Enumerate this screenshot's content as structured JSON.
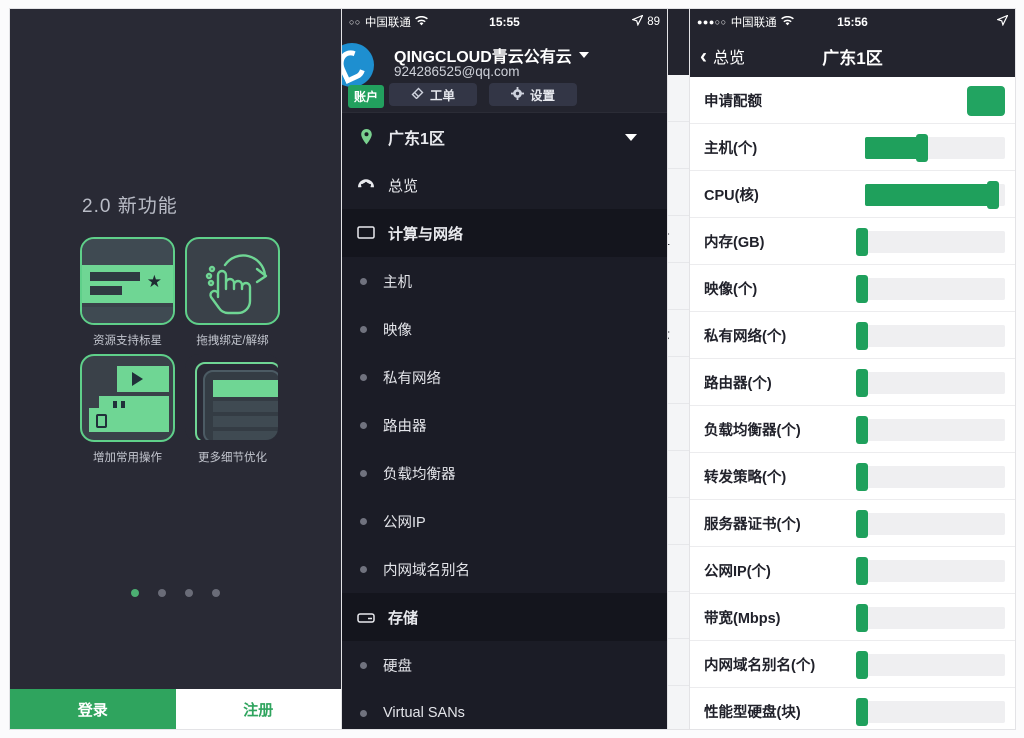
{
  "onboarding": {
    "title": "2.0 新功能",
    "features": [
      {
        "caption": "资源支持标星",
        "art": "starred-card"
      },
      {
        "caption": "拖拽绑定/解绑",
        "art": "drag-hand"
      },
      {
        "caption": "增加常用操作",
        "art": "quick-actions"
      },
      {
        "caption": "更多细节优化",
        "art": "list-detail"
      }
    ],
    "pager": {
      "total": 4,
      "active": 1
    },
    "login_label": "登录",
    "register_label": "注册",
    "accent": "#2fa45e",
    "background": "#292a35"
  },
  "console": {
    "statusbar": {
      "signal_dots": "○○",
      "carrier": "中国联通",
      "wifi_icon": "wifi-icon",
      "time": "15:55",
      "location_icon": "location-arrow-icon",
      "battery": "89"
    },
    "account": {
      "name": "QINGCLOUD青云公有云",
      "email": "924286525@qq.com",
      "badge": "账户",
      "ticket_label": "工单",
      "settings_label": "设置",
      "avatar_icon": "qingcloud-logo-icon",
      "dropdown_icon": "caret-down-icon"
    },
    "zone": {
      "label": "广东1区",
      "pin_icon": "location-pin-icon",
      "caret_icon": "caret-down-icon"
    },
    "menu": [
      {
        "label": "总览",
        "type": "item",
        "icon": "dashboard-icon"
      },
      {
        "label": "计算与网络",
        "type": "section",
        "icon": "monitor-icon"
      },
      {
        "label": "主机",
        "type": "sub",
        "icon": "bullet-icon"
      },
      {
        "label": "映像",
        "type": "sub",
        "icon": "bullet-icon"
      },
      {
        "label": "私有网络",
        "type": "sub",
        "icon": "bullet-icon"
      },
      {
        "label": "路由器",
        "type": "sub",
        "icon": "bullet-icon"
      },
      {
        "label": "负载均衡器",
        "type": "sub",
        "icon": "bullet-icon"
      },
      {
        "label": "公网IP",
        "type": "sub",
        "icon": "bullet-icon"
      },
      {
        "label": "内网域名别名",
        "type": "sub",
        "icon": "bullet-icon"
      },
      {
        "label": "存储",
        "type": "section",
        "icon": "storage-icon"
      },
      {
        "label": "硬盘",
        "type": "sub",
        "icon": "bullet-icon"
      },
      {
        "label": "Virtual SANs",
        "type": "sub",
        "icon": "bullet-icon"
      }
    ]
  },
  "quota": {
    "statusbar": {
      "signal_dots": "●●●○○",
      "carrier": "中国联通",
      "wifi_icon": "wifi-icon",
      "time": "15:56",
      "location_icon": "location-arrow-icon"
    },
    "nav": {
      "back_label": "总览",
      "back_icon": "chevron-left-icon",
      "title": "广东1区"
    },
    "apply_label": "申请配额",
    "apply_button_icon": "apply-quota-button",
    "items": [
      {
        "label": "主机(个)",
        "percent": 45
      },
      {
        "label": "CPU(核)",
        "percent": 96
      },
      {
        "label": "内存(GB)",
        "percent": 2
      },
      {
        "label": "映像(个)",
        "percent": 2
      },
      {
        "label": "私有网络(个)",
        "percent": 2
      },
      {
        "label": "路由器(个)",
        "percent": 2
      },
      {
        "label": "负载均衡器(个)",
        "percent": 2
      },
      {
        "label": "转发策略(个)",
        "percent": 2
      },
      {
        "label": "服务器证书(个)",
        "percent": 2
      },
      {
        "label": "公网IP(个)",
        "percent": 2
      },
      {
        "label": "带宽(Mbps)",
        "percent": 2
      },
      {
        "label": "内网域名别名(个)",
        "percent": 2
      },
      {
        "label": "性能型硬盘(块)",
        "percent": 2
      }
    ],
    "bar_color": "#1fa05c",
    "track_color": "#efeff1"
  },
  "sliver": {
    "rows": [
      "",
      "",
      "",
      "区",
      "",
      "云",
      "",
      "",
      "",
      "",
      "",
      "",
      ""
    ]
  }
}
